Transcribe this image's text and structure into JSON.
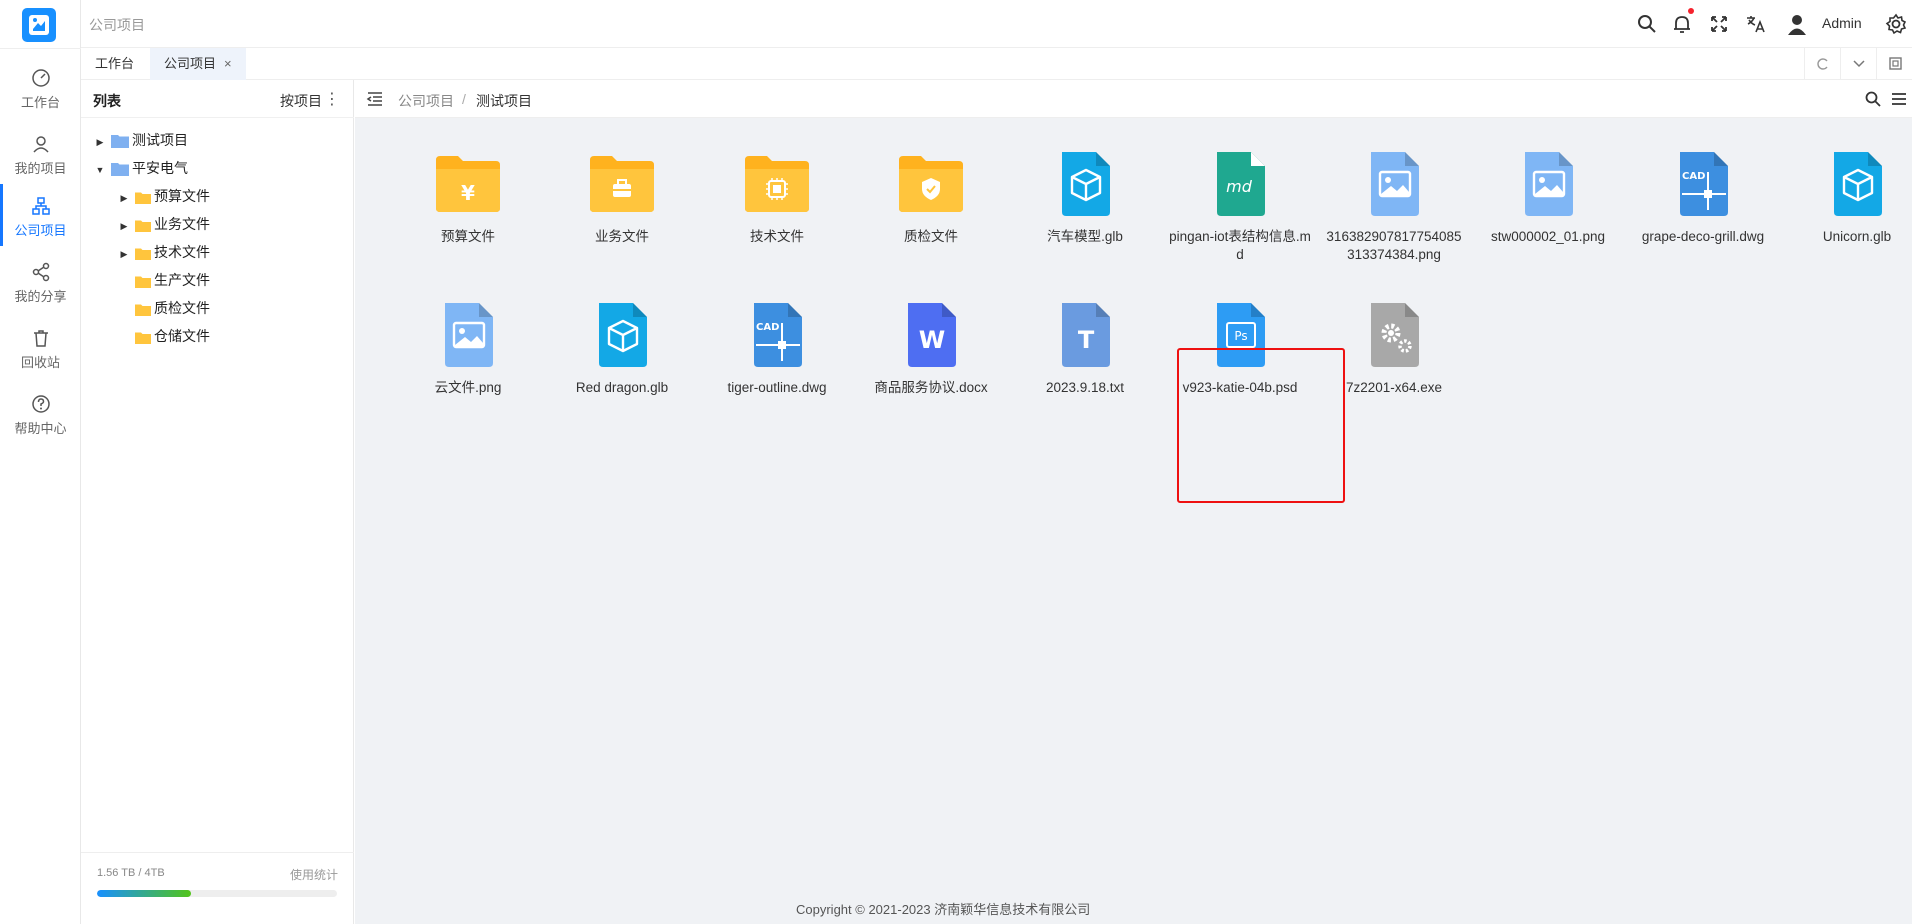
{
  "header": {
    "title": "公司项目",
    "user": "Admin"
  },
  "sidebar": {
    "items": [
      {
        "label": "工作台",
        "icon": "dashboard-icon"
      },
      {
        "label": "我的项目",
        "icon": "user-icon"
      },
      {
        "label": "公司项目",
        "icon": "org-icon"
      },
      {
        "label": "我的分享",
        "icon": "share-icon"
      },
      {
        "label": "回收站",
        "icon": "trash-icon"
      },
      {
        "label": "帮助中心",
        "icon": "help-icon"
      }
    ]
  },
  "tabs": [
    {
      "label": "工作台"
    },
    {
      "label": "公司项目",
      "close": "×"
    }
  ],
  "panel": {
    "title": "列表",
    "sort_label": "按项目",
    "tree": [
      {
        "label": "测试项目"
      },
      {
        "label": "平安电气"
      },
      {
        "label": "预算文件"
      },
      {
        "label": "业务文件"
      },
      {
        "label": "技术文件"
      },
      {
        "label": "生产文件"
      },
      {
        "label": "质检文件"
      },
      {
        "label": "仓储文件"
      }
    ],
    "storage": {
      "used": "1.56 TB / 4TB",
      "stats_label": "使用统计",
      "fraction": 0.39
    }
  },
  "breadcrumb": {
    "parent": "公司项目",
    "separator": "/",
    "current": "测试项目"
  },
  "files": [
    {
      "name": "预算文件",
      "type": "folder",
      "glyph": "¥"
    },
    {
      "name": "业务文件",
      "type": "folder",
      "glyph": "briefcase"
    },
    {
      "name": "技术文件",
      "type": "folder",
      "glyph": "chip"
    },
    {
      "name": "质检文件",
      "type": "folder",
      "glyph": "shield"
    },
    {
      "name": "汽车模型.glb",
      "type": "glb"
    },
    {
      "name": "pingan-iot表结构信息.md",
      "type": "md"
    },
    {
      "name": "316382907817754085313374384.png",
      "type": "png"
    },
    {
      "name": "stw000002_01.png",
      "type": "png"
    },
    {
      "name": "grape-deco-grill.dwg",
      "type": "dwg"
    },
    {
      "name": "Unicorn.glb",
      "type": "glb"
    },
    {
      "name": "云文件.png",
      "type": "png"
    },
    {
      "name": "Red dragon.glb",
      "type": "glb"
    },
    {
      "name": "tiger-outline.dwg",
      "type": "dwg"
    },
    {
      "name": "商品服务协议.docx",
      "type": "docx"
    },
    {
      "name": "2023.9.18.txt",
      "type": "txt"
    },
    {
      "name": "v923-katie-04b.psd",
      "type": "psd"
    },
    {
      "name": "7z2201-x64.exe",
      "type": "exe"
    }
  ],
  "file_type_labels": {
    "md": "md",
    "dwg": "CAD",
    "docx": "W",
    "txt": "T",
    "psd": "Ps"
  },
  "footer": {
    "copyright": "Copyright © 2021-2023 济南颖华信息技术有限公司"
  },
  "colors": {
    "accent": "#1677ff",
    "folder": "#ffc53d",
    "glb": "#13a8e6",
    "md": "#1fa890",
    "png": "#7fb6f5",
    "dwg": "#3d8fe0",
    "docx": "#4e6ef2",
    "txt": "#6a9be0",
    "psd": "#2d9cf4",
    "exe": "#a8a8a8",
    "selection": "#e11111"
  }
}
